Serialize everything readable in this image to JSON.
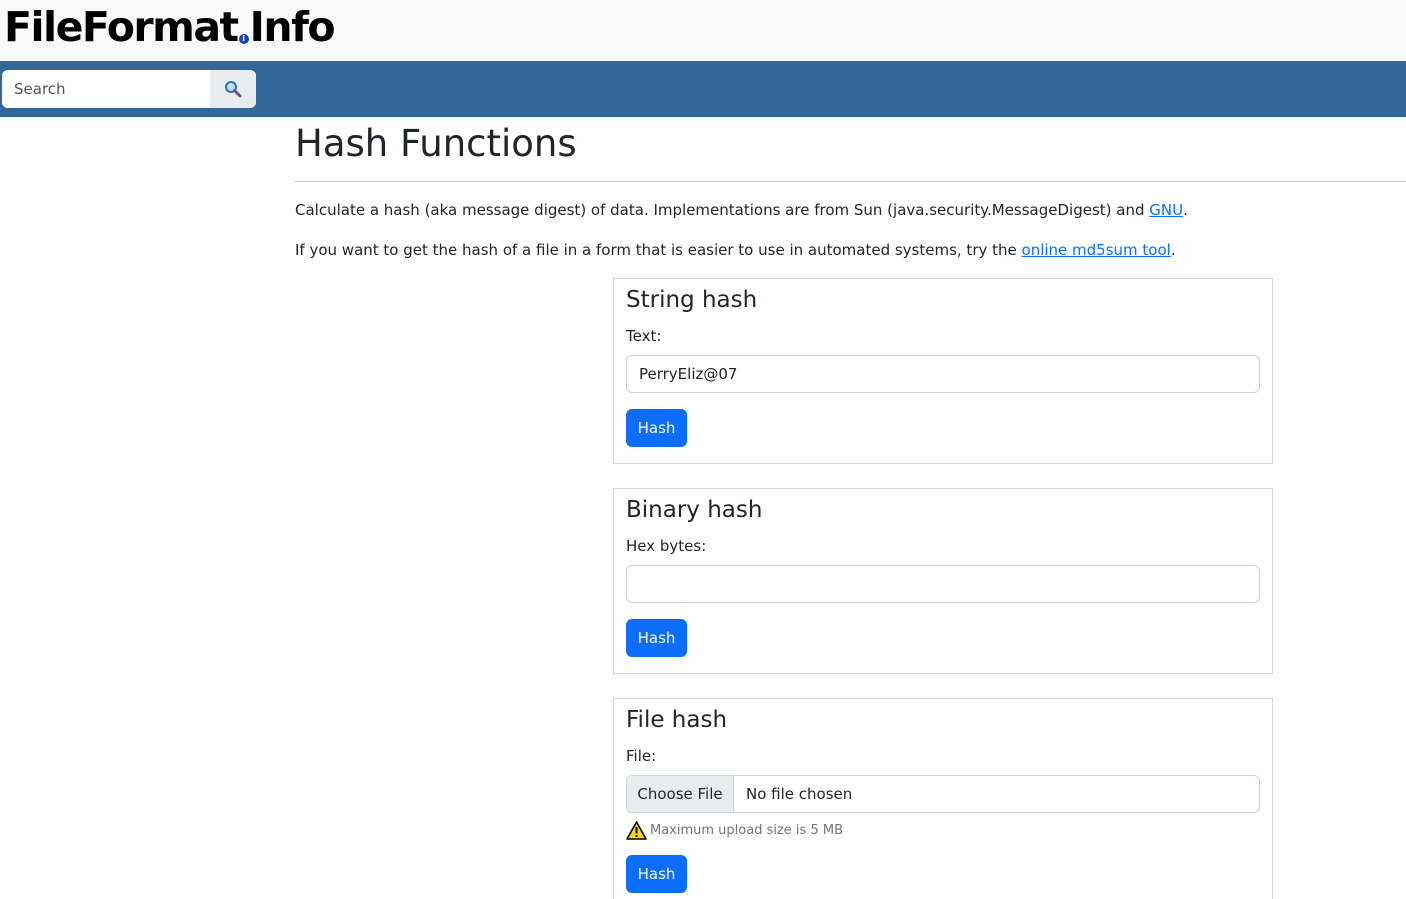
{
  "header": {
    "logo_main": "FileFormat",
    "logo_dot": "i",
    "logo_tail": "Info"
  },
  "nav": {
    "search_placeholder": "Search",
    "search_icon": "magnifier-icon"
  },
  "page": {
    "title": "Hash Functions",
    "intro_before": "Calculate a hash (aka message digest) of data. Implementations are from Sun (java.security.MessageDigest) and ",
    "intro_link": "GNU",
    "intro_after": ".",
    "tool_before": "If you want to get the hash of a file in a form that is easier to use in automated systems, try the ",
    "tool_link": "online md5sum tool",
    "tool_after": "."
  },
  "string_hash": {
    "title": "String hash",
    "label": "Text:",
    "value": "PerryEliz@07",
    "button": "Hash"
  },
  "binary_hash": {
    "title": "Binary hash",
    "label": "Hex bytes:",
    "value": "",
    "button": "Hash"
  },
  "file_hash": {
    "title": "File hash",
    "label": "File:",
    "choose_button": "Choose File",
    "no_file": "No file chosen",
    "note_icon": "warning-icon",
    "note": "Maximum upload size is 5 MB",
    "button": "Hash"
  },
  "colors": {
    "navbar": "#336699",
    "primary": "#0d6efd",
    "link": "#0d6efd"
  }
}
